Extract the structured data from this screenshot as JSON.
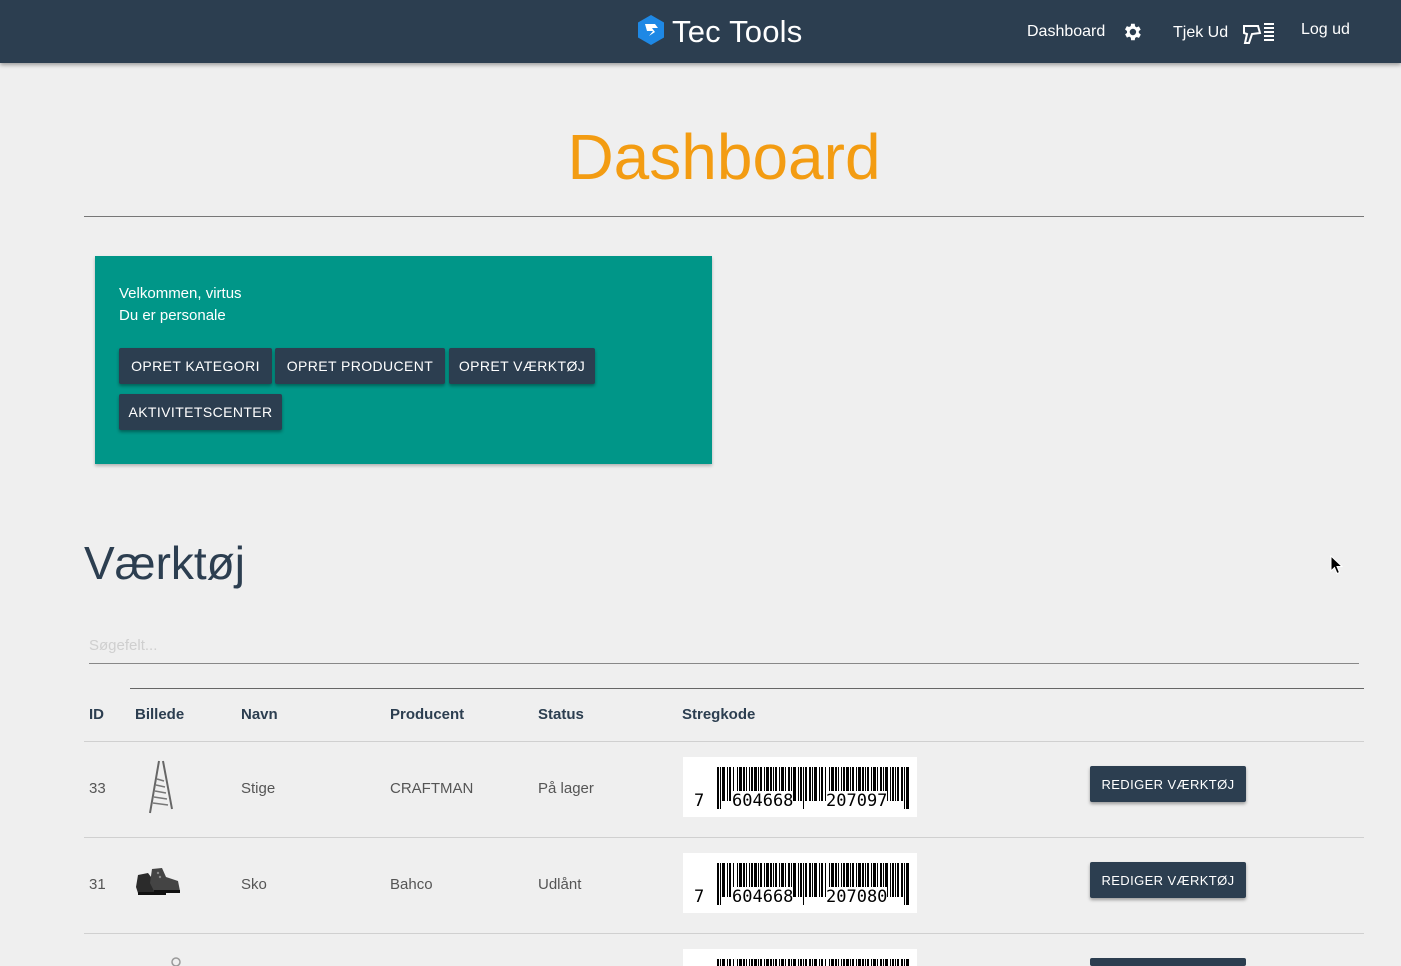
{
  "navbar": {
    "brand": "Tec Tools",
    "links": {
      "dashboard": "Dashboard",
      "checkout": "Tjek Ud",
      "logout": "Log ud"
    }
  },
  "page": {
    "title": "Dashboard"
  },
  "welcome": {
    "greeting": "Velkommen, virtus",
    "role": "Du er personale",
    "buttons": {
      "create_category": "OPRET KATEGORI",
      "create_producer": "OPRET PRODUCENT",
      "create_tool": "OPRET VÆRKTØJ",
      "activity_center": "AKTIVITETSCENTER"
    }
  },
  "tools": {
    "title": "Værktøj",
    "search_placeholder": "Søgefelt...",
    "columns": {
      "id": "ID",
      "image": "Billede",
      "name": "Navn",
      "producer": "Producent",
      "status": "Status",
      "barcode": "Stregkode"
    },
    "edit_label": "REDIGER VÆRKTØJ",
    "rows": [
      {
        "id": "33",
        "image": "ladder-image",
        "name": "Stige",
        "producer": "CRAFTMAN",
        "status": "På lager",
        "barcode_first": "7",
        "barcode_left": "604668",
        "barcode_right": "207097"
      },
      {
        "id": "31",
        "image": "shoes-image",
        "name": "Sko",
        "producer": "Bahco",
        "status": "Udlånt",
        "barcode_first": "7",
        "barcode_left": "604668",
        "barcode_right": "207080"
      }
    ]
  },
  "colors": {
    "navbar": "#2c3e50",
    "accent": "#f39c12",
    "card": "#009688",
    "background": "#efefef"
  }
}
